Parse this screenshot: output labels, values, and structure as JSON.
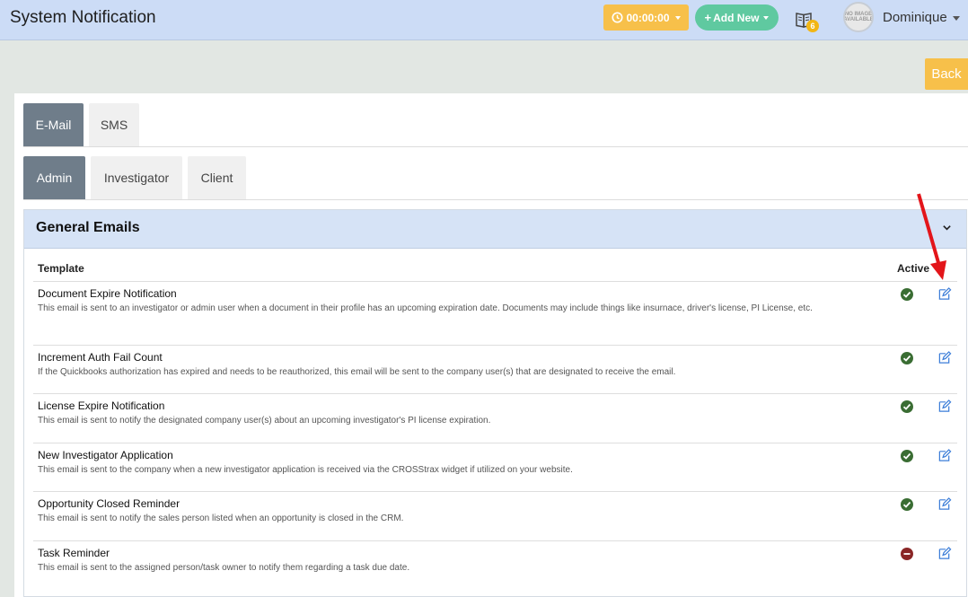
{
  "header": {
    "title": "System Notification",
    "timer_label": "00:00:00",
    "add_new_label": "Add New",
    "notification_count": "6",
    "avatar_text": "NO IMAGE AVAILABLE",
    "user_name": "Dominique"
  },
  "back_label": "Back",
  "channel_tabs": [
    {
      "label": "E-Mail",
      "active": true
    },
    {
      "label": "SMS",
      "active": false
    }
  ],
  "audience_tabs": [
    {
      "label": "Admin",
      "active": true
    },
    {
      "label": "Investigator",
      "active": false
    },
    {
      "label": "Client",
      "active": false
    }
  ],
  "section": {
    "title": "General Emails",
    "columns": {
      "template": "Template",
      "active": "Active"
    },
    "rows": [
      {
        "name": "Document Expire Notification",
        "description": "This email is sent to an investigator or admin user when a document in their profile has an upcoming expiration date. Documents may include things like insurnace, driver's license, PI License, etc.",
        "active": true
      },
      {
        "name": "Increment Auth Fail Count",
        "description": "If the Quickbooks authorization has expired and needs to be reauthorized, this email will be sent to the company user(s) that are designated to receive the email.",
        "active": true
      },
      {
        "name": "License Expire Notification",
        "description": "This email is sent to notify the designated company user(s) about an upcoming investigator's PI license expiration.",
        "active": true
      },
      {
        "name": "New Investigator Application",
        "description": "This email is sent to the company when a new investigator application is received via the CROSStrax widget if utilized on your website.",
        "active": true
      },
      {
        "name": "Opportunity Closed Reminder",
        "description": "This email is sent to notify the sales person listed when an opportunity is closed in the CRM.",
        "active": true
      },
      {
        "name": "Task Reminder",
        "description": "This email is sent to the assigned person/task owner to notify them regarding a task due date.",
        "active": false
      }
    ]
  },
  "colors": {
    "header_bg": "#ccdcf6",
    "timer_bg": "#f7c04a",
    "add_new_bg": "#5fc9a0",
    "tab_active_bg": "#6f7d8a",
    "status_active": "#3a6d33",
    "status_inactive": "#8a2626",
    "edit_icon": "#3b7dd8",
    "annotation_arrow": "#e3151a"
  }
}
